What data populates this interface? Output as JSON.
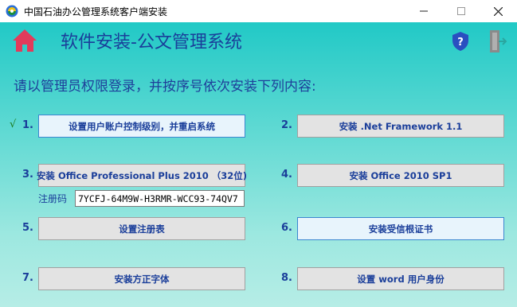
{
  "window": {
    "title": "中国石油办公管理系统客户端安装",
    "min_icon": "minimize-icon",
    "max_icon": "maximize-icon",
    "close_icon": "close-icon"
  },
  "header": {
    "title": "软件安装-公文管理系统",
    "home_icon": "home-icon",
    "help_icon": "help-shield-icon",
    "exit_icon": "exit-door-icon"
  },
  "instruction": "请以管理员权限登录，并按序号依次安装下列内容:",
  "done_mark": "√",
  "steps": [
    {
      "num": "1.",
      "label": "设置用户账户控制级别，并重启系统"
    },
    {
      "num": "2.",
      "label": "安装 .Net Framework 1.1"
    },
    {
      "num": "3.",
      "label": "安装 Office Professional Plus 2010 （32位)"
    },
    {
      "num": "4.",
      "label": "安装 Office 2010 SP1"
    },
    {
      "num": "5.",
      "label": "设置注册表"
    },
    {
      "num": "6.",
      "label": "安装受信根证书"
    },
    {
      "num": "7.",
      "label": "安装方正字体"
    },
    {
      "num": "8.",
      "label": "设置 word 用户身份"
    }
  ],
  "registration": {
    "label": "注册码",
    "value": "7YCFJ-64M9W-H3RMR-WCC93-74QV7"
  },
  "colors": {
    "accent_text": "#1a3e9a",
    "home_icon": "#e23b5b",
    "help_shield": "#2a4fc0",
    "check": "#1a7a1a"
  }
}
